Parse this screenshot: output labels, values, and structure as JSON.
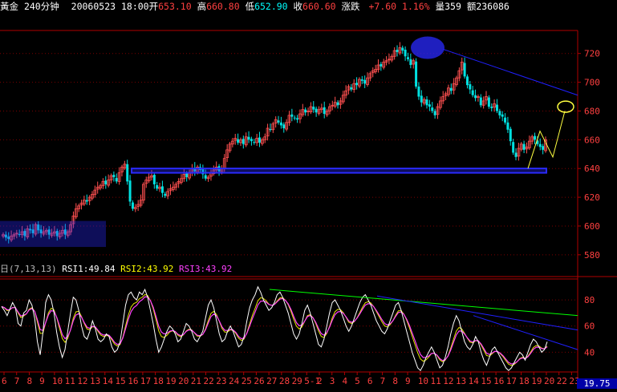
{
  "header": {
    "symbol": "黃金",
    "period": "240分钟",
    "datetime": "20060523 18:00",
    "open_label": "开",
    "open": "653.10",
    "high_label": "高",
    "high": "660.80",
    "low_label": "低",
    "low": "652.90",
    "close_label": "收",
    "close": "660.60",
    "change_label": "涨跌",
    "change": "+7.60",
    "change_pct": "1.16%",
    "volume_label": "量",
    "volume": "359",
    "amount_label": "额",
    "amount": "236086"
  },
  "rsi_header": {
    "prefix": "日",
    "params": "(7,13,13)",
    "rsi1_label": "RSI1:",
    "rsi1": "49.84",
    "rsi2_label": "RSI2:",
    "rsi2": "43.92",
    "rsi3_label": "RSI3:",
    "rsi3": "43.92"
  },
  "bottom_badge": "19.75",
  "colors": {
    "up": "#ff5050",
    "down": "#00e0e0",
    "grid": "#7a0000",
    "axis": "#b00000",
    "annot_blue": "#2a2aff",
    "annot_yellow": "#ffff40",
    "rsi1": "#ffffff",
    "rsi2": "#ffff00",
    "rsi3": "#ff40ff",
    "trend_green": "#00ff00",
    "trend_blue": "#2020ff",
    "axis_text": "#ff4040"
  },
  "chart_data": [
    {
      "type": "candlestick",
      "title": "黃金 240分钟",
      "y_ticks": [
        580,
        600,
        620,
        640,
        660,
        680,
        700,
        720
      ],
      "ylim": [
        576,
        736
      ],
      "x_ticks": [
        "6",
        "7",
        "8",
        "9",
        "10",
        "11",
        "12",
        "13",
        "14",
        "15",
        "16",
        "17",
        "18",
        "19",
        "20",
        "21",
        "22",
        "23",
        "24",
        "25",
        "26",
        "27",
        "28",
        "29",
        "5-1",
        "2",
        "3",
        "4",
        "5",
        "6",
        "7",
        "8",
        "9",
        "10",
        "11",
        "12",
        "13",
        "14",
        "15",
        "16",
        "17",
        "18",
        "19",
        "20",
        "22",
        "23"
      ],
      "close_path": [
        594,
        592,
        591,
        593,
        594,
        595,
        594,
        596,
        593,
        598,
        597,
        595,
        601,
        597,
        595,
        596,
        597,
        594,
        595,
        596,
        593,
        595,
        597,
        594,
        596,
        601,
        607,
        612,
        614,
        616,
        618,
        617,
        620,
        622,
        625,
        627,
        628,
        631,
        629,
        632,
        635,
        634,
        631,
        637,
        641,
        643,
        631,
        617,
        612,
        613,
        615,
        618,
        629,
        632,
        634,
        635,
        629,
        626,
        627,
        623,
        621,
        624,
        626,
        627,
        629,
        631,
        633,
        636,
        634,
        637,
        640,
        638,
        641,
        639,
        636,
        633,
        634,
        637,
        639,
        641,
        638,
        640,
        647,
        653,
        657,
        659,
        661,
        658,
        660,
        657,
        662,
        660,
        659,
        658,
        661,
        658,
        660,
        662,
        668,
        667,
        671,
        674,
        672,
        670,
        668,
        672,
        677,
        676,
        675,
        674,
        678,
        681,
        679,
        680,
        683,
        681,
        679,
        681,
        682,
        678,
        680,
        683,
        684,
        686,
        684,
        687,
        691,
        694,
        697,
        695,
        699,
        698,
        702,
        701,
        699,
        703,
        706,
        708,
        709,
        712,
        711,
        714,
        715,
        716,
        718,
        722,
        721,
        724,
        722,
        718,
        716,
        712,
        715,
        697,
        690,
        686,
        688,
        684,
        683,
        680,
        677,
        683,
        687,
        690,
        692,
        696,
        694,
        699,
        703,
        708,
        714,
        704,
        698,
        695,
        691,
        689,
        690,
        684,
        687,
        690,
        683,
        682,
        685,
        680,
        677,
        676,
        672,
        667,
        659,
        651,
        648,
        654,
        657,
        653,
        655,
        659,
        662,
        660,
        657,
        655,
        653,
        660
      ],
      "annotations": {
        "support_zone": [
          637,
          640
        ],
        "box_zone": [
          586,
          603
        ],
        "projected_target": 683
      }
    },
    {
      "type": "line",
      "title": "RSI (7,13,13)",
      "y_ticks": [
        40,
        60,
        80
      ],
      "ylim": [
        20,
        96
      ],
      "series": [
        {
          "name": "RSI1",
          "color": "#ffffff"
        },
        {
          "name": "RSI2",
          "color": "#ffff00"
        },
        {
          "name": "RSI3",
          "color": "#ff40ff"
        }
      ],
      "rsi1_path": [
        75,
        72,
        68,
        73,
        78,
        74,
        62,
        60,
        70,
        72,
        80,
        76,
        66,
        48,
        38,
        55,
        78,
        84,
        80,
        70,
        55,
        44,
        36,
        42,
        56,
        70,
        82,
        80,
        72,
        60,
        52,
        50,
        56,
        64,
        58,
        50,
        48,
        50,
        54,
        52,
        44,
        40,
        42,
        48,
        62,
        76,
        84,
        86,
        82,
        80,
        86,
        84,
        88,
        82,
        72,
        62,
        50,
        40,
        44,
        50,
        56,
        60,
        58,
        54,
        48,
        50,
        56,
        62,
        60,
        56,
        50,
        48,
        52,
        56,
        66,
        76,
        80,
        74,
        64,
        54,
        48,
        50,
        56,
        60,
        56,
        50,
        44,
        46,
        52,
        64,
        74,
        80,
        84,
        90,
        86,
        80,
        76,
        72,
        74,
        78,
        84,
        86,
        82,
        76,
        70,
        62,
        54,
        50,
        54,
        62,
        72,
        76,
        70,
        62,
        54,
        46,
        44,
        50,
        60,
        70,
        78,
        80,
        76,
        72,
        66,
        60,
        56,
        60,
        66,
        72,
        78,
        82,
        84,
        80,
        76,
        70,
        64,
        60,
        56,
        54,
        58,
        64,
        70,
        76,
        78,
        72,
        64,
        56,
        48,
        40,
        34,
        28,
        26,
        30,
        36,
        40,
        44,
        40,
        34,
        28,
        30,
        36,
        44,
        54,
        62,
        68,
        64,
        56,
        48,
        44,
        42,
        46,
        52,
        48,
        40,
        34,
        30,
        36,
        42,
        44,
        40,
        36,
        32,
        28,
        26,
        28,
        32,
        36,
        40,
        38,
        34,
        40,
        46,
        50,
        48,
        44,
        40,
        42,
        48
      ]
    }
  ]
}
